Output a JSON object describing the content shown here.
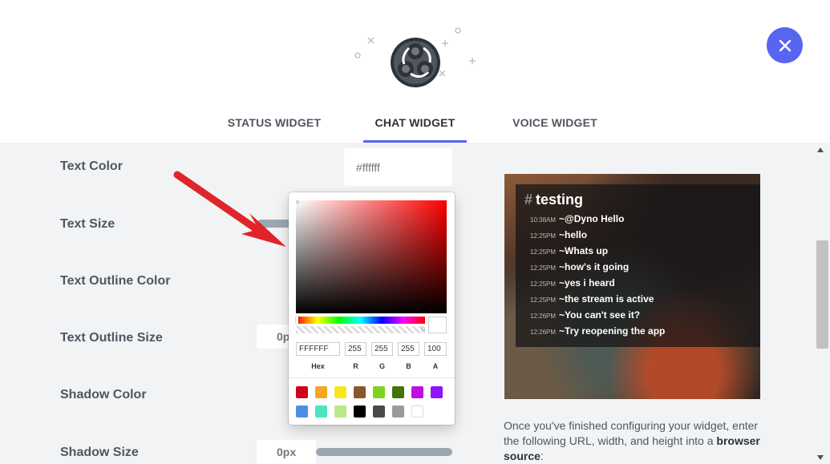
{
  "header": {
    "logo_icon": "obs-logo-icon",
    "close_icon": "close-icon"
  },
  "tabs": [
    {
      "label": "STATUS WIDGET",
      "active": false
    },
    {
      "label": "CHAT WIDGET",
      "active": true
    },
    {
      "label": "VOICE WIDGET",
      "active": false
    }
  ],
  "settings": {
    "text_color": {
      "label": "Text Color",
      "value": "#ffffff"
    },
    "text_size": {
      "label": "Text Size"
    },
    "text_outline_color": {
      "label": "Text Outline Color"
    },
    "text_outline_size": {
      "label": "Text Outline Size",
      "value": "0px"
    },
    "shadow_color": {
      "label": "Shadow Color"
    },
    "shadow_size": {
      "label": "Shadow Size",
      "value": "0px"
    }
  },
  "color_picker": {
    "hex": "FFFFFF",
    "r": "255",
    "g": "255",
    "b": "255",
    "a": "100",
    "labels": {
      "hex": "Hex",
      "r": "R",
      "g": "G",
      "b": "B",
      "a": "A"
    },
    "alpha_zero": "0",
    "swatches": [
      "#d0021b",
      "#f5a623",
      "#f8e71c",
      "#8b572a",
      "#7ed321",
      "#417505",
      "#bd10e0",
      "#9013fe",
      "#4a90e2",
      "#50e3c2",
      "#b8e986",
      "#000000",
      "#4a4a4a",
      "#9b9b9b",
      "#ffffff"
    ]
  },
  "preview": {
    "channel": "testing",
    "messages": [
      {
        "time": "10:38AM",
        "text": "~@Dyno Hello"
      },
      {
        "time": "12:25PM",
        "text": "~hello"
      },
      {
        "time": "12:25PM",
        "text": "~Whats up"
      },
      {
        "time": "12:25PM",
        "text": "~how's it going"
      },
      {
        "time": "12:25PM",
        "text": "~yes i heard"
      },
      {
        "time": "12:25PM",
        "text": "~the stream is active"
      },
      {
        "time": "12:26PM",
        "text": "~You can't see it?"
      },
      {
        "time": "12:26PM",
        "text": "~Try reopening the app"
      }
    ]
  },
  "instructions": {
    "text": "Once you've finished configuring your widget, enter the following URL, width, and height into a ",
    "bold": "browser source",
    "suffix": ":"
  },
  "colors": {
    "accent": "#5865f2",
    "annotation_arrow": "#e0242a"
  }
}
